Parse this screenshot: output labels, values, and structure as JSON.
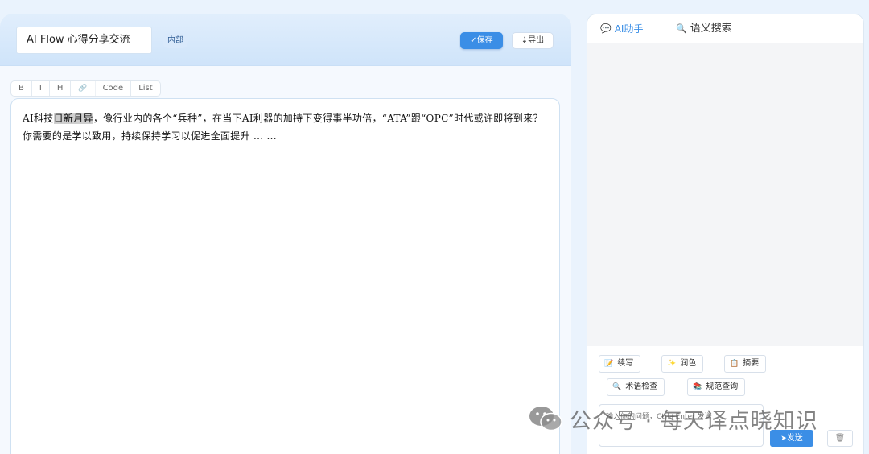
{
  "editor": {
    "doc_title": "AI Flow 心得分享交流",
    "tag": "内部",
    "save_label": "✓保存",
    "export_label": "⇣导出",
    "toolbar": [
      "B",
      "I",
      "H",
      "🔗",
      "Code",
      "List"
    ],
    "text_before": "AI科技",
    "text_highlight": "日新月异",
    "text_after": "，像行业内的各个“兵种”，在当下AI利器的加持下变得事半功倍，“ATA”跟“OPC”时代或许即将到来？你需要的是学以致用，持续保持学习以促进全面提升 ... ..."
  },
  "ai_panel": {
    "tab_ai": "AI助手",
    "tab_search": "语义搜索",
    "actions": [
      {
        "icon": "pencil-icon",
        "glyph": "📝",
        "label": "续写"
      },
      {
        "icon": "sparkle-icon",
        "glyph": "✨",
        "label": "润色"
      },
      {
        "icon": "clipboard-icon",
        "glyph": "📋",
        "label": "摘要"
      },
      {
        "icon": "magnifier-icon",
        "glyph": "🔍",
        "label": "术语检查"
      },
      {
        "icon": "books-icon",
        "glyph": "📚",
        "label": "规范查询"
      }
    ],
    "input_placeholder": "输入你的问题，Ctrl+Enter 发送",
    "send_label": "发送",
    "clear_glyph": "🗑"
  },
  "watermark": {
    "text": "公众号 · 每天译点晓知识"
  },
  "colors": {
    "accent": "#3b8ee6",
    "header_bg": "#d6e8fb",
    "page_bg": "#eaf3fd"
  }
}
